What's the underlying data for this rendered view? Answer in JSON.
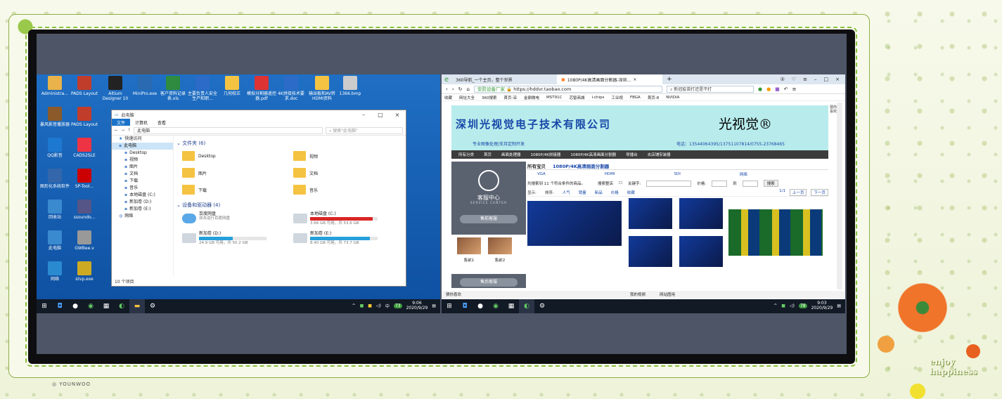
{
  "colors": {
    "frame_green": "#8ac040",
    "tv_bezel": "#0e0e10",
    "win_blue": "#1f6fc4",
    "taskbar": "#121a26",
    "shop_cyan": "#b8ecec",
    "shop_blue": "#1646a8"
  },
  "decoration": {
    "watermark": "YOUNWOO",
    "enjoy_line1": "enjoy",
    "enjoy_line2": "happiness"
  },
  "left": {
    "desktop_icons": [
      {
        "label": "Administra...",
        "icon": "folder-icon"
      },
      {
        "label": "PADS Layout",
        "icon": "pads-icon"
      },
      {
        "label": "Altium Designer 10",
        "icon": "altium-icon"
      },
      {
        "label": "MiniPro.exe",
        "icon": "minipro-icon"
      },
      {
        "label": "客户资料记录表.xls",
        "icon": "excel-icon"
      },
      {
        "label": "主要负责人安全生产和职...",
        "icon": "word-icon"
      },
      {
        "label": "几何校正",
        "icon": "file-icon"
      },
      {
        "label": "模拟分割器遥控器.pdf",
        "icon": "pdf-icon"
      },
      {
        "label": "4K拼接技术要求.doc",
        "icon": "word-icon"
      },
      {
        "label": "输出板和AV转HDMI资料",
        "icon": "folder-icon"
      },
      {
        "label": "1366.bmp",
        "icon": "image-icon"
      },
      {
        "label": "暴风影音播放器",
        "icon": "baofeng-icon"
      },
      {
        "label": "PADS Layout",
        "icon": "pads-icon"
      },
      {
        "label": "QQ影音",
        "icon": "qqplayer-icon"
      },
      {
        "label": "CADS2SLE",
        "icon": "cad-icon"
      },
      {
        "label": "图形化系统软件",
        "icon": "app-icon"
      },
      {
        "label": "SP-Tool...",
        "icon": "sptool-icon"
      },
      {
        "label": "回收站",
        "icon": "recycle-icon"
      },
      {
        "label": "ssoundo...",
        "icon": "app-icon"
      },
      {
        "label": "此电脑",
        "icon": "computer-icon"
      },
      {
        "label": "GWBee.v",
        "icon": "app-icon"
      },
      {
        "label": "网络",
        "icon": "network-icon"
      },
      {
        "label": "stvp.exe",
        "icon": "stvp-icon"
      }
    ],
    "explorer": {
      "title": "此电脑",
      "ribbon_tabs": [
        "文件",
        "计算机",
        "查看"
      ],
      "path": "此电脑",
      "search_placeholder": "搜索\"此电脑\"",
      "nav": [
        "快速访问",
        "此电脑",
        "Desktop",
        "视频",
        "图片",
        "文档",
        "下载",
        "音乐",
        "本地磁盘 (C:)",
        "新加卷 (D:)",
        "新加卷 (E:)",
        "网络"
      ],
      "folders_title": "文件夹 (6)",
      "folders": [
        "Desktop",
        "视频",
        "图片",
        "文档",
        "下载",
        "音乐"
      ],
      "drives_title": "设备和驱动器 (4)",
      "drives": [
        {
          "name": "百度网盘",
          "sub": "双击运行百度网盘",
          "fill": 0
        },
        {
          "name": "本地磁盘 (C:)",
          "sub": "3.66 GB 可用，共 53.6 GB",
          "fill": 0.93
        },
        {
          "name": "新加卷 (D:)",
          "sub": "24.9 GB 可用，共 50.2 GB",
          "fill": 0.5
        },
        {
          "name": "新加卷 (E:)",
          "sub": "8.40 GB 可用，共 73.7 GB",
          "fill": 0.89
        }
      ],
      "status": "10 个项目"
    },
    "taskbar": {
      "time": "9:06",
      "date": "2020/9/29",
      "tray_text": "中",
      "badge": "73"
    }
  },
  "right": {
    "tabs": [
      "360导航_一个主页，整个世界",
      "1080P/4K高清画面分割器-深圳..."
    ],
    "url": "https://hddvr.taobao.com",
    "secure_label": "安防设备厂家",
    "search_text": "新冠疫苗打还是不打",
    "bookmarks": [
      "收藏",
      "网址大全",
      "360搜索",
      "首页-深",
      "金鼎微电",
      "MST91C",
      "芯智商城",
      "i-chips",
      "工业视",
      "FBGA",
      "首页-8",
      "NVIDIA"
    ],
    "shop": {
      "name": "深圳光视觉电子技术有限公司",
      "brand": "光视觉®",
      "slogan": "专业图像处理/支持定制开发",
      "tel": "电话：13544064395/13751107814/0755-23768465",
      "nav": [
        "所有分类",
        "首页",
        "画面处理器",
        "1080P/4K拼接器",
        "1080P/4K高清画面分割器",
        "导播台",
        "去店铺安装器"
      ],
      "service_title": "客服中心",
      "service_sub": "SERVICE CENTER",
      "presale": "售前客服",
      "aftersale": "售后客服",
      "thumbs": [
        "售前1",
        "售前2"
      ],
      "crumbs": [
        "所有宝贝",
        "1080P/4K高清画面分割器"
      ],
      "subcats": [
        "VGA",
        "HDMI",
        "SDI",
        "网络"
      ],
      "found": "共搜索到 11 个符合条件的商品。",
      "filter_labels": [
        "搜索整店",
        "关键字:",
        "价格:",
        "到"
      ],
      "search_btn": "搜索",
      "sort": [
        "显示:",
        "排序:",
        "人气",
        "销量",
        "新品",
        "价格",
        "收藏"
      ],
      "pager": [
        "1/1",
        "上一页",
        "下一页"
      ],
      "side_feed": "猜你喜欢"
    },
    "status": [
      "猜你喜欢",
      "我的视频",
      "网站图用"
    ],
    "taskbar": {
      "time": "9:03",
      "date": "2020/9/29",
      "badge": "78"
    }
  }
}
